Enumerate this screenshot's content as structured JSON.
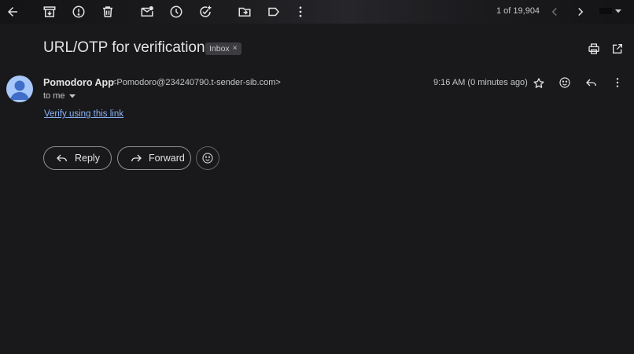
{
  "toolbar": {
    "icons": [
      "back-arrow-icon",
      "archive-icon",
      "report-spam-icon",
      "delete-icon",
      "mark-unread-icon",
      "snooze-icon",
      "add-to-tasks-icon",
      "move-to-icon",
      "label-icon",
      "more-vert-icon"
    ],
    "counter": "1 of 19,904"
  },
  "message": {
    "subject": "URL/OTP for verification",
    "label": "Inbox",
    "label_remove": "×",
    "sender_name": "Pomodoro App",
    "sender_email": "<Pomodoro@234240790.t-sender-sib.com>",
    "recipient": "to me",
    "timestamp": "9:16 AM (0 minutes ago)",
    "body_link": "Verify using this link"
  },
  "actions": {
    "reply": "Reply",
    "forward": "Forward"
  },
  "colors": {
    "background": "#19191b",
    "text": "#e3e3e3",
    "muted": "#c4c7c5",
    "link": "#8ab4f8",
    "avatar": "#a8c7fa"
  }
}
